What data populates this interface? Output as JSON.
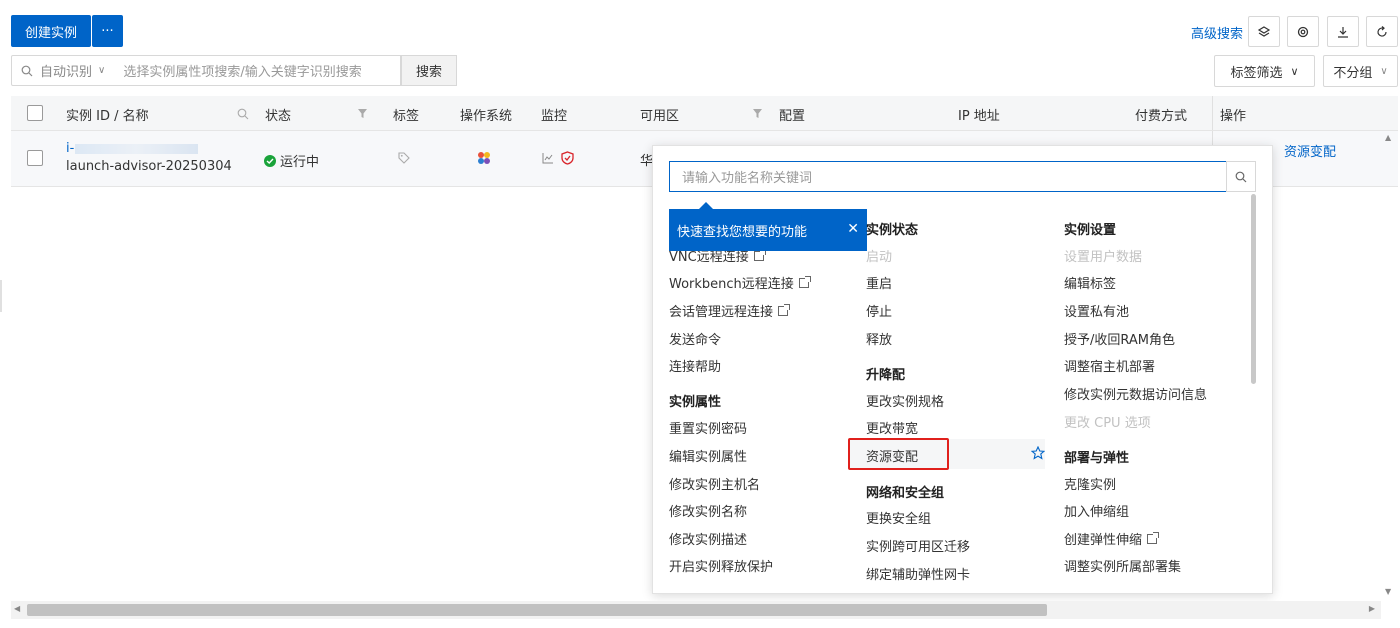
{
  "toolbar": {
    "create_label": "创建实例",
    "more_label": "···",
    "advanced_search": "高级搜索"
  },
  "search": {
    "mode": "自动识别",
    "placeholder": "选择实例属性项搜索/输入关键字识别搜索",
    "button": "搜索"
  },
  "filters": {
    "tag_filter": "标签筛选",
    "group": "不分组"
  },
  "table": {
    "headers": [
      "实例 ID / 名称",
      "状态",
      "标签",
      "操作系统",
      "监控",
      "可用区",
      "配置",
      "IP 地址",
      "付费方式",
      "操作"
    ],
    "row": {
      "id": "i-",
      "name": "launch-advisor-20250304",
      "status": "运行中",
      "zone_partial": "华",
      "action_resource": "资源变配"
    }
  },
  "popup": {
    "search_placeholder": "请输入功能名称关键词",
    "tooltip": "快速查找您想要的功能",
    "col1": {
      "items": [
        "VNC远程连接",
        "Workbench远程连接",
        "会话管理远程连接",
        "发送命令",
        "连接帮助"
      ],
      "attr_head": "实例属性",
      "attr_items": [
        "重置实例密码",
        "编辑实例属性",
        "修改实例主机名",
        "修改实例名称",
        "修改实例描述",
        "开启实例释放保护"
      ]
    },
    "col2": {
      "state_head": "实例状态",
      "state_items": [
        "启动",
        "重启",
        "停止",
        "释放"
      ],
      "upgrade_head": "升降配",
      "upgrade_items": [
        "更改实例规格",
        "更改带宽",
        "资源变配"
      ],
      "net_head": "网络和安全组",
      "net_items": [
        "更换安全组",
        "实例跨可用区迁移",
        "绑定辅助弹性网卡"
      ]
    },
    "col3": {
      "settings_head": "实例设置",
      "settings_items": [
        "设置用户数据",
        "编辑标签",
        "设置私有池",
        "授予/收回RAM角色",
        "调整宿主机部署",
        "修改实例元数据访问信息",
        "更改 CPU 选项"
      ],
      "deploy_head": "部署与弹性",
      "deploy_items": [
        "克隆实例",
        "加入伸缩组",
        "创建弹性伸缩",
        "调整实例所属部署集"
      ]
    }
  },
  "colors": {
    "primary": "#0064c8",
    "success": "#1aa33a",
    "highlight": "#e0201c"
  }
}
